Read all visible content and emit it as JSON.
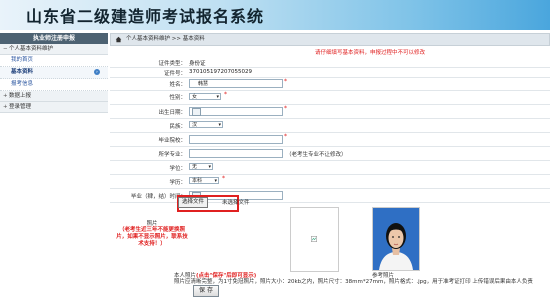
{
  "app": {
    "title": "山东省二级建造师考试报名系统"
  },
  "sidebar": {
    "header": "执业师注册申报",
    "group1": "个人基本资料维护",
    "items": [
      "我的首页",
      "基本资料",
      "报考信息"
    ],
    "group2": "数据上报",
    "group3": "登录管理"
  },
  "breadcrumb": "个人基本资料维护 >> 基本资料",
  "notice": "请仔细填写基本资料，申报过程中不可以修改",
  "form": {
    "id_type_label": "证件类型：",
    "id_type_value": "身份证",
    "id_no_label": "证件号：",
    "id_no_value": "370105197207055029",
    "name_label": "姓名：",
    "name_value": "韩慧",
    "gender_label": "性别：",
    "gender_value": "女",
    "birth_label": "出生日期：",
    "ethnic_label": "民族：",
    "ethnic_value": "汉",
    "school_label": "毕业院校：",
    "major_label": "所学专业：",
    "major_note": "（老考生专业不让修改）",
    "degree_label": "学位：",
    "degree_value": "无",
    "edu_label": "学历：",
    "edu_value": "本科",
    "grad_label": "毕业（肄，结）时间：",
    "photo_label": "照片",
    "photo_warning": "（老考生近三年不能更换照片，如果不显示照片，联系技术支持！）",
    "file_button": "选择文件",
    "file_status": "未选择文件",
    "personal_photo_label": "本人照片",
    "click_save_note": "(点击\"保存\"后即可显示)",
    "sample_label": "参考照片",
    "requirements": "照片应清晰完整，为1寸免冠照片，照片大小：20kb之内，照片尺寸：38mm*27mm，照片格式：.jpg，用于准考证打印 上传错误后果由本人负责",
    "save_button": "保 存"
  }
}
